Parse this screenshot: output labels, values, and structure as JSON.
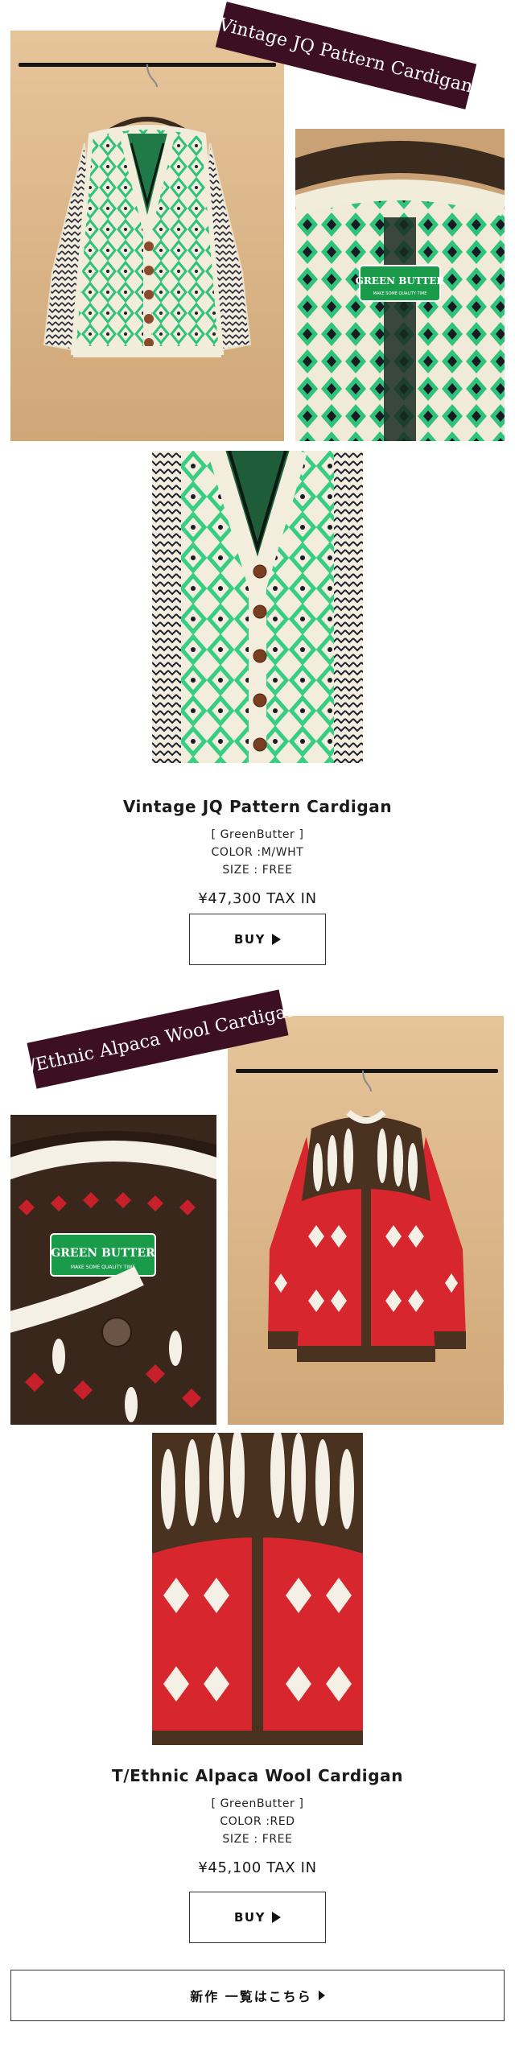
{
  "products": [
    {
      "banner": "Vintage JQ Pattern Cardigan",
      "name": "Vintage JQ Pattern Cardigan",
      "brand": "[ GreenButter ]",
      "color": "COLOR :M/WHT",
      "size": "SIZE : FREE",
      "price": "¥47,300 TAX IN",
      "buy_label": "BUY",
      "label_tag": {
        "brand": "GREEN BUTTER",
        "tagline": "MAKE SOME QUALITY TIME"
      }
    },
    {
      "banner": "T/Ethnic Alpaca Wool Cardigan",
      "name": "T/Ethnic Alpaca Wool Cardigan",
      "brand": "[ GreenButter ]",
      "color": "COLOR :RED",
      "size": "SIZE : FREE",
      "price": "¥45,100 TAX IN",
      "buy_label": "BUY",
      "label_tag": {
        "brand": "GREEN BUTTER",
        "tagline": "MAKE SOME QUALITY TIME"
      }
    }
  ],
  "new_arrivals_label": "新作 一覧はこちら",
  "icons": {
    "buy_arrow": "play-triangle-icon",
    "new_arrow": "play-triangle-icon"
  },
  "colors": {
    "ribbon": "#3c0f22",
    "backdrop": "#ddb88c",
    "cardigan1_green": "#2fc27a",
    "cardigan2_red": "#d8262e"
  }
}
